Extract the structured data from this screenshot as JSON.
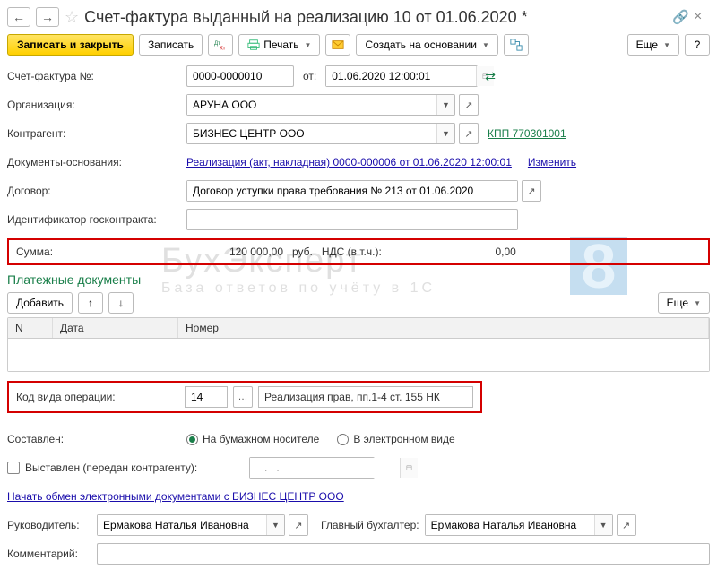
{
  "title": "Счет-фактура выданный на реализацию 10 от 01.06.2020 *",
  "toolbar": {
    "save_close": "Записать и закрыть",
    "save": "Записать",
    "print": "Печать",
    "create_basis": "Создать на основании",
    "more": "Еще"
  },
  "labels": {
    "number": "Счет-фактура №:",
    "date_from": "от:",
    "org": "Организация:",
    "counterparty": "Контрагент:",
    "basis_docs": "Документы-основания:",
    "contract": "Договор:",
    "gos_id": "Идентификатор госконтракта:",
    "sum": "Сумма:",
    "currency": "руб.",
    "vat_label": "НДС (в т.ч.):",
    "payment_docs": "Платежные документы",
    "add": "Добавить",
    "th_n": "N",
    "th_date": "Дата",
    "th_num": "Номер",
    "op_code": "Код вида операции:",
    "composed": "Составлен:",
    "radio_paper": "На бумажном носителе",
    "radio_electronic": "В электронном виде",
    "issued": "Выставлен (передан контрагенту):",
    "director": "Руководитель:",
    "accountant": "Главный бухгалтер:",
    "comment": "Комментарий:",
    "change": "Изменить"
  },
  "fields": {
    "number": "0000-0000010",
    "date": "01.06.2020 12:00:01",
    "org": "АРУНА ООО",
    "counterparty": "БИЗНЕС ЦЕНТР ООО",
    "kpp_link": "КПП 770301001",
    "basis_link": "Реализация (акт, накладная) 0000-000006 от 01.06.2020 12:00:01",
    "contract": "Договор уступки права требования № 213 от 01.06.2020",
    "gos_id": "",
    "sum": "120 000,00",
    "vat": "0,00",
    "op_code": "14",
    "op_code_desc": "Реализация прав, пп.1-4 ст. 155 НК",
    "issued_date": "   .   .     ",
    "edo_link": "Начать обмен электронными документами с БИЗНЕС ЦЕНТР ООО",
    "director": "Ермакова Наталья Ивановна",
    "accountant": "Ермакова Наталья Ивановна",
    "comment": ""
  },
  "watermark": {
    "line1": "БухЭксперт",
    "line2": "База  ответов  по  учёту  в  1С",
    "badge": "8"
  }
}
